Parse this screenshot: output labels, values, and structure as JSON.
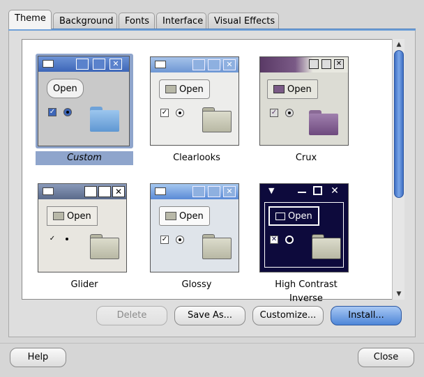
{
  "tabs": [
    {
      "label": "Theme",
      "active": true
    },
    {
      "label": "Background",
      "active": false
    },
    {
      "label": "Fonts",
      "active": false
    },
    {
      "label": "Interface",
      "active": false
    },
    {
      "label": "Visual Effects",
      "active": false
    }
  ],
  "themes": [
    {
      "name": "Custom",
      "selected": true,
      "open_label": "Open"
    },
    {
      "name": "Clearlooks",
      "selected": false,
      "open_label": "Open"
    },
    {
      "name": "Crux",
      "selected": false,
      "open_label": "Open"
    },
    {
      "name": "Glider",
      "selected": false,
      "open_label": "Open"
    },
    {
      "name": "Glossy",
      "selected": false,
      "open_label": "Open"
    },
    {
      "name": "High Contrast Inverse",
      "selected": false,
      "open_label": "Open"
    }
  ],
  "actions": {
    "delete": "Delete",
    "save_as": "Save As...",
    "customize": "Customize...",
    "install": "Install..."
  },
  "footer": {
    "help": "Help",
    "close": "Close"
  },
  "colors": {
    "accent": "#4e86d8",
    "selection": "#8fa5cc",
    "crux_purple": "#5a3a66",
    "hc_navy": "#0d0a3c"
  }
}
